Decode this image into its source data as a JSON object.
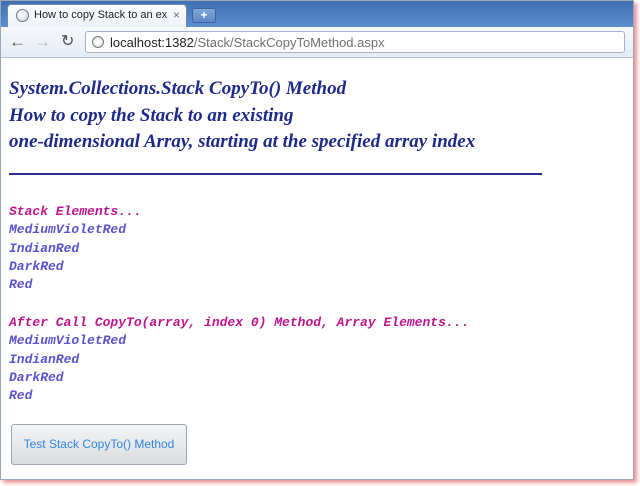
{
  "browser": {
    "tab_title": "How to copy Stack to an ex",
    "tab_close": "×",
    "new_tab": "+",
    "url_host": "localhost:1382",
    "url_path": "/Stack/StackCopyToMethod.aspx"
  },
  "page": {
    "heading_lines": [
      "System.Collections.Stack CopyTo() Method",
      "How to copy the Stack to an existing",
      "one-dimensional Array, starting at the specified array index"
    ],
    "stack_label": "Stack Elements...",
    "stack_items": [
      "MediumVioletRed",
      "IndianRed",
      "DarkRed",
      "Red"
    ],
    "array_label": "After Call CopyTo(array, index 0) Method, Array Elements...",
    "array_items": [
      "MediumVioletRed",
      "IndianRed",
      "DarkRed",
      "Red"
    ],
    "button_label": "Test Stack CopyTo() Method"
  },
  "colors": {
    "heading": "#1e2a8a",
    "label": "#c0148e",
    "item": "#5a52cf",
    "button_text": "#2f86e0"
  },
  "icons": {
    "back": "back-arrow-icon",
    "forward": "forward-arrow-icon",
    "reload": "reload-icon",
    "page": "page-icon"
  }
}
